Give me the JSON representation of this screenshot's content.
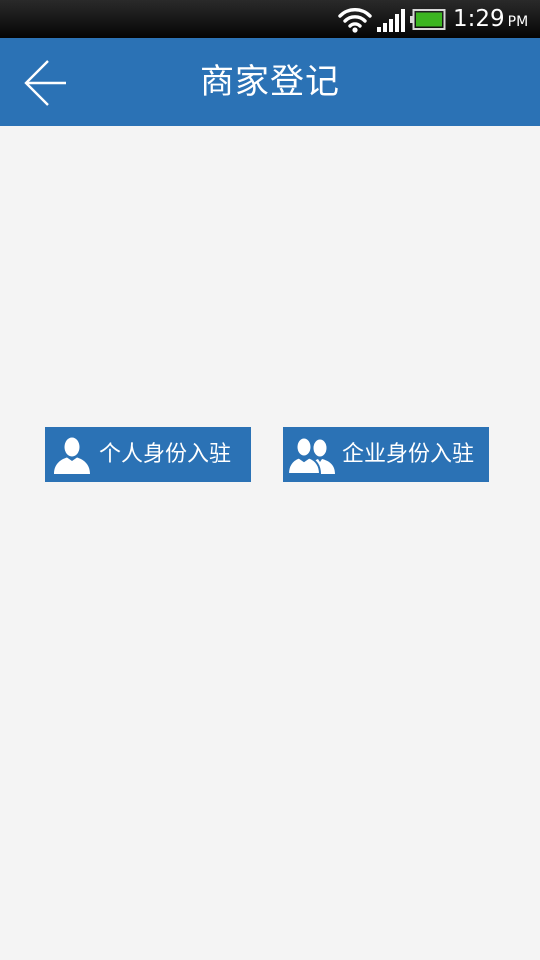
{
  "status_bar": {
    "time": "1:29",
    "ampm": "PM",
    "icons": [
      "wifi-icon",
      "signal-icon",
      "battery-icon"
    ],
    "battery_color": "#3cb521"
  },
  "header": {
    "title": "商家登记",
    "back_icon": "arrow-left-icon",
    "background_color": "#2b72b5"
  },
  "main": {
    "background_color": "#f4f4f4",
    "buttons": [
      {
        "label": "个人身份入驻",
        "icon": "person-icon"
      },
      {
        "label": "企业身份入驻",
        "icon": "group-icon"
      }
    ]
  }
}
